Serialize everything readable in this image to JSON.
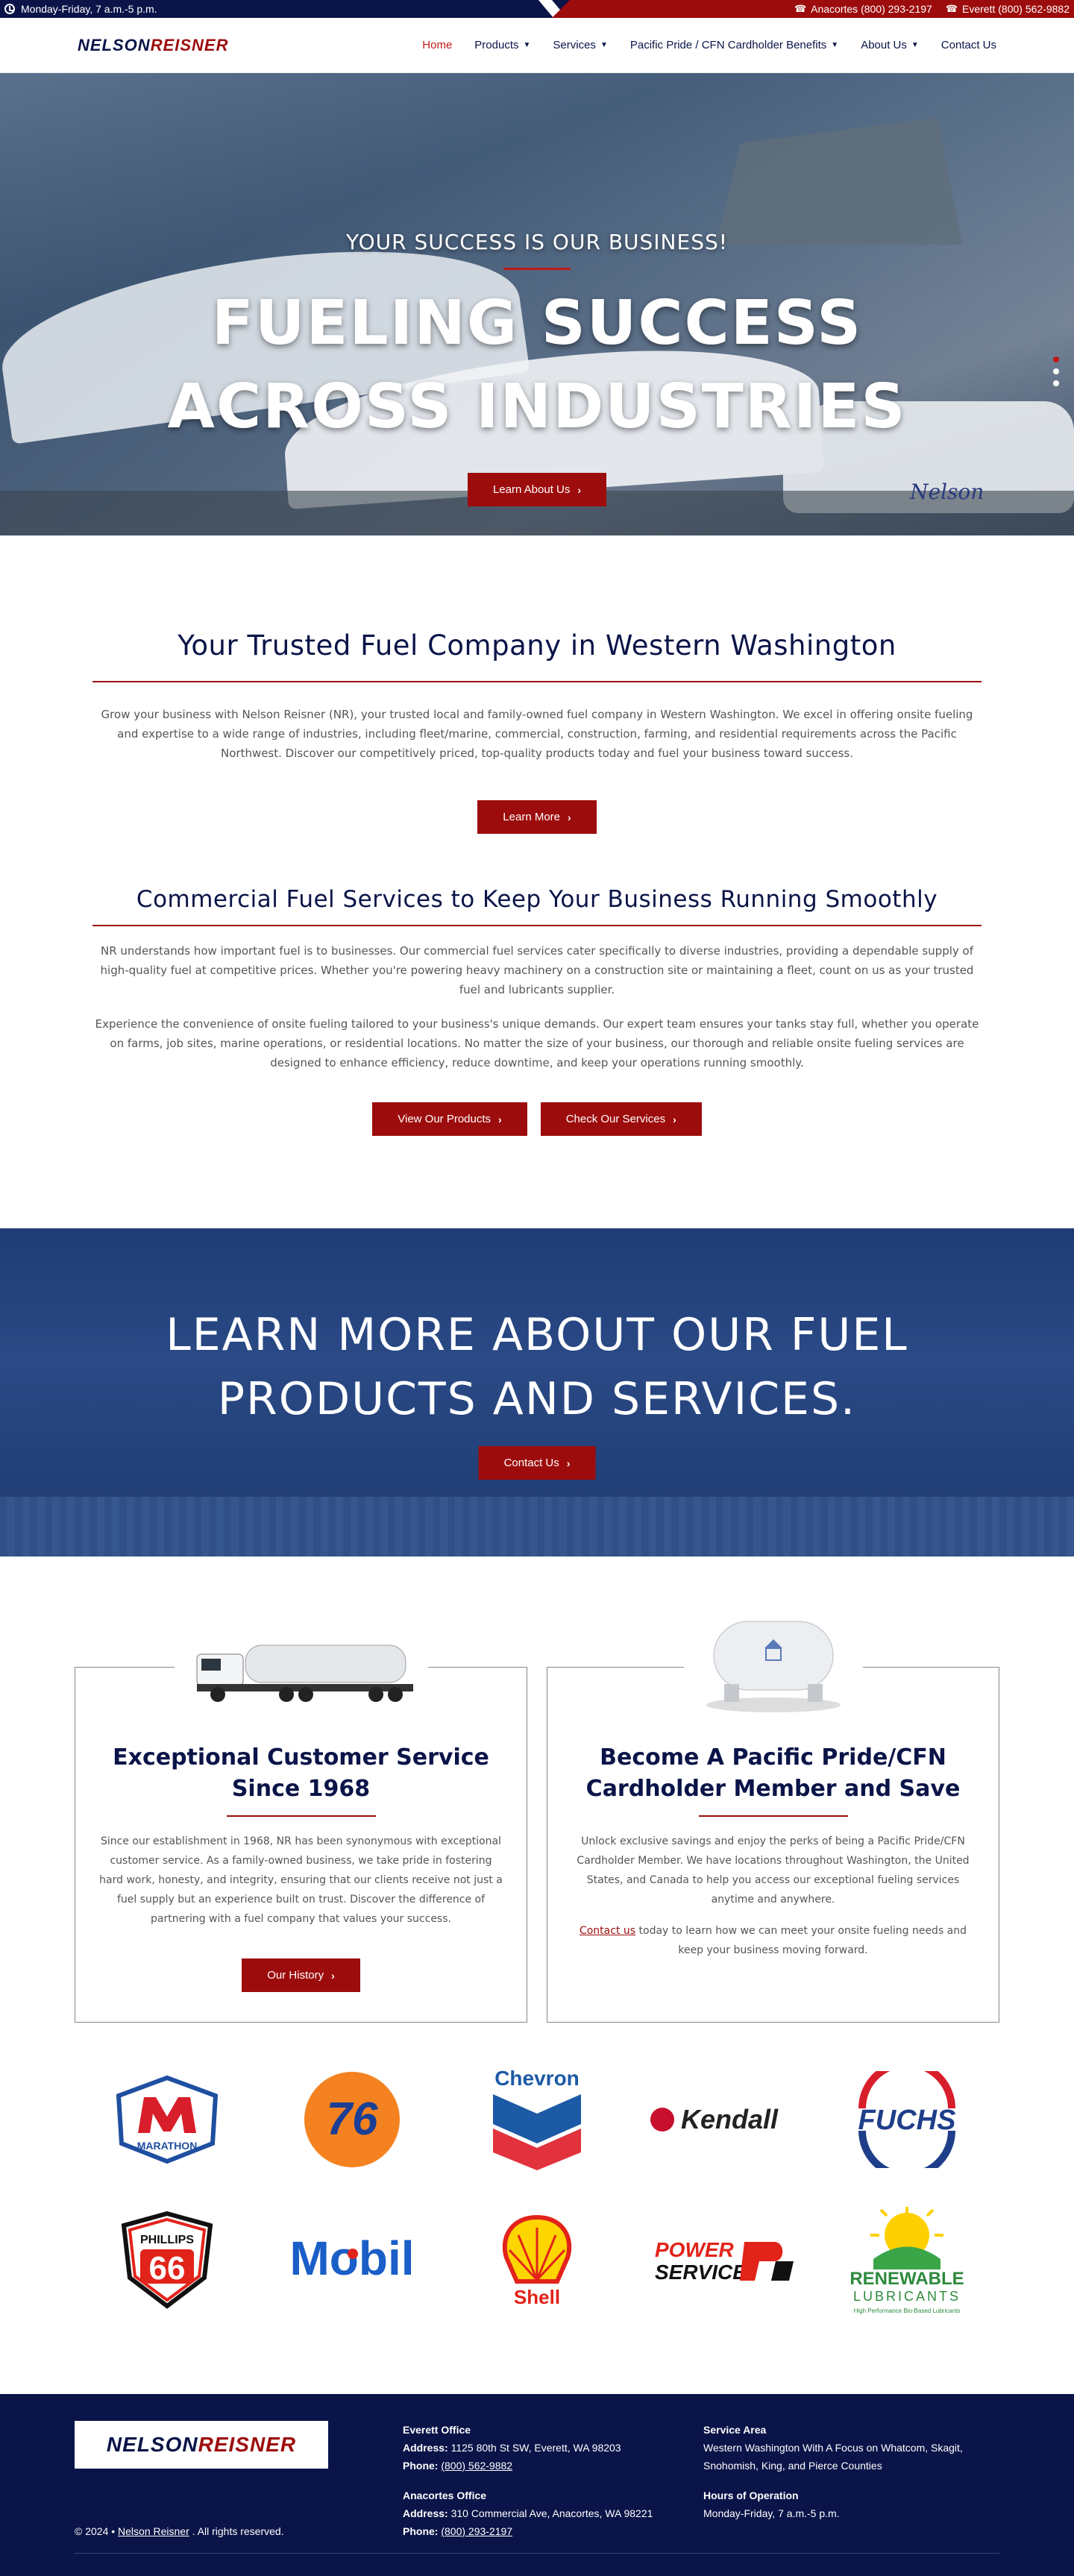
{
  "topbar": {
    "hours": "Monday-Friday, 7 a.m.-5 p.m.",
    "phone1": "Anacortes (800) 293-2197",
    "phone2": "Everett (800) 562-9882"
  },
  "header": {
    "logo_a": "NELSON",
    "logo_b": "REISNER",
    "nav": [
      "Home",
      "Products",
      "Services",
      "Pacific Pride / CFN Cardholder Benefits",
      "About Us",
      "Contact Us"
    ]
  },
  "hero": {
    "subtitle": "Your Success is Our Business!",
    "title_line1": "FUELING SUCCESS",
    "title_line2": "ACROSS INDUSTRIES",
    "button": "Learn About Us",
    "tank_text": "Nelson"
  },
  "intro": {
    "title": "Your Trusted Fuel Company in Western Washington",
    "text": "Grow your business with Nelson Reisner (NR), your trusted local and family-owned fuel company in Western Washington. We excel in offering onsite fueling and expertise to a wide range of industries, including fleet/marine, commercial, construction, farming, and residential requirements across the Pacific Northwest. Discover our competitively priced, top-quality products today and fuel your business toward success.",
    "button": "Learn More"
  },
  "commercial": {
    "title": "Commercial Fuel Services to Keep Your Business Running Smoothly",
    "p1": "NR understands how important fuel is to businesses. Our commercial fuel services cater specifically to diverse industries, providing a dependable supply of high-quality fuel at competitive prices. Whether you're powering heavy machinery on a construction site or maintaining a fleet, count on us as your trusted fuel and lubricants supplier.",
    "p2": "Experience the convenience of onsite fueling tailored to your business's unique demands. Our expert team ensures your tanks stay full, whether you operate on farms, job sites, marine operations, or residential locations. No matter the size of your business, our thorough and reliable onsite fueling services are designed to enhance efficiency, reduce downtime, and keep your operations running smoothly.",
    "button1": "View Our Products",
    "button2": "Check Our Services"
  },
  "cta": {
    "line1": "LEARN MORE ABOUT OUR FUEL",
    "line2": "PRODUCTS AND SERVICES.",
    "button": "Contact Us"
  },
  "cards": {
    "left": {
      "title_line1": "Exceptional Customer Service",
      "title_line2": "Since 1968",
      "text": "Since our establishment in 1968, NR has been synonymous with exceptional customer service. As a family-owned business, we take pride in fostering hard work, honesty, and integrity, ensuring that our clients receive not just a fuel supply but an experience built on trust. Discover the difference of partnering with a fuel company that values your success.",
      "button": "Our History"
    },
    "right": {
      "title_line1": "Become A Pacific Pride/CFN",
      "title_line2": "Cardholder Member and Save",
      "text": "Unlock exclusive savings and enjoy the perks of being a Pacific Pride/CFN Cardholder Member. We have locations throughout Washington, the United States, and Canada to help you access our exceptional fueling services anytime and anywhere.",
      "link": "Contact us",
      "text2": " today to learn how we can meet your onsite fueling needs and keep your business moving forward."
    }
  },
  "brands": {
    "marathon": "MARATHON",
    "seventysix": "76",
    "chevron": "Chevron",
    "kendall": "Kendall",
    "fuchs": "FUCHS",
    "phillips": "PHILLIPS",
    "phillips66": "66",
    "mobil": "Mobil",
    "shell": "Shell",
    "power1": "POWER",
    "power2": "SERVICE",
    "renewable1": "RENEWABLE",
    "renewable2": "LUBRICANTS",
    "renewable3": "High Performance Bio-Based Lubricants"
  },
  "footer": {
    "copy_prefix": "© 2024 •",
    "copy_link": "Nelson Reisner",
    "copy_suffix": ". All rights reserved.",
    "everett_title": "Everett Office",
    "everett_address_label": "Address:",
    "everett_address": "1125 80th St SW, Everett, WA 98203",
    "everett_phone_label": "Phone:",
    "everett_phone": "(800) 562-9882",
    "anacortes_title": "Anacortes Office",
    "anacortes_address_label": "Address:",
    "anacortes_address": "310 Commercial Ave, Anacortes, WA 98221",
    "anacortes_phone_label": "Phone:",
    "anacortes_phone": "(800) 293-2197",
    "service_title": "Service Area",
    "service_text": "Western Washington With A Focus on Whatcom, Skagit, Snohomish, King, and Pierce Counties",
    "hours_title": "Hours of Operation",
    "hours_text": "Monday-Friday, 7 a.m.-5 p.m."
  },
  "colors": {
    "navy": "#0a1448",
    "red": "#9d0c0c",
    "accent": "#c01818"
  }
}
